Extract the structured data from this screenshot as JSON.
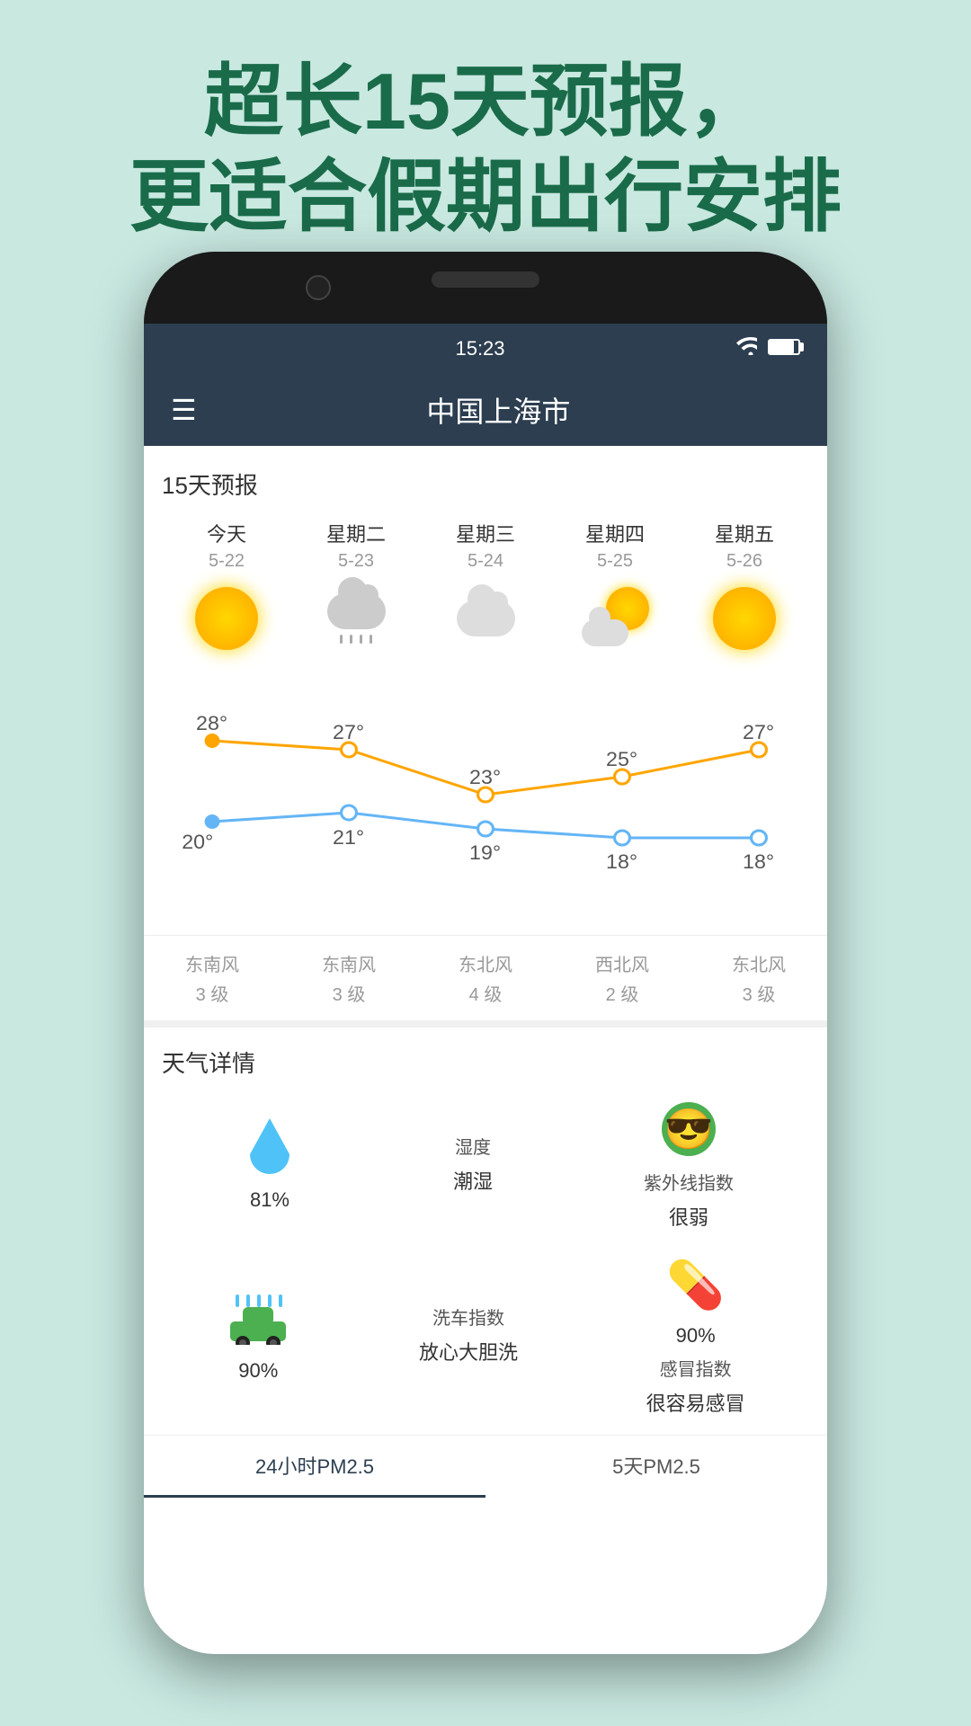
{
  "header": {
    "line1": "超长15天预报，",
    "line2": "更适合假期出行安排"
  },
  "statusBar": {
    "time": "15:23",
    "wifi": "📶",
    "battery": "🔋"
  },
  "appBar": {
    "title": "中国上海市",
    "menuIcon": "☰"
  },
  "weather": {
    "sectionTitle": "15天预报",
    "days": [
      {
        "name": "今天",
        "date": "5-22",
        "type": "sunny",
        "high": 28,
        "low": 20,
        "windDir": "东南风",
        "windLevel": "3 级"
      },
      {
        "name": "星期二",
        "date": "5-23",
        "type": "rainy",
        "high": 27,
        "low": 21,
        "windDir": "东南风",
        "windLevel": "3 级"
      },
      {
        "name": "星期三",
        "date": "5-24",
        "type": "cloudy",
        "high": 23,
        "low": 19,
        "windDir": "东北风",
        "windLevel": "4 级"
      },
      {
        "name": "星期四",
        "date": "5-25",
        "type": "suncloudy",
        "high": 25,
        "low": 18,
        "windDir": "西北风",
        "windLevel": "2 级"
      },
      {
        "name": "星期五",
        "date": "5-26",
        "type": "sunny",
        "high": 27,
        "low": 18,
        "windDir": "东北风",
        "windLevel": "3 级"
      }
    ]
  },
  "details": {
    "sectionTitle": "天气详情",
    "items": [
      {
        "icon": "waterdrop",
        "label": "",
        "value": "81%",
        "name": "humidity"
      },
      {
        "icon": "none",
        "label": "湿度",
        "value": "潮湿",
        "name": "humidity-label"
      },
      {
        "icon": "smiley",
        "label": "紫外线指数",
        "value": "",
        "name": "uv-index"
      },
      {
        "icon": "carwash",
        "label": "",
        "value": "90%",
        "name": "carwash"
      },
      {
        "icon": "none",
        "label": "洗车指数",
        "value": "放心大胆洗",
        "name": "carwash-label"
      },
      {
        "icon": "pill",
        "label": "感冒指数",
        "value": "",
        "name": "cold-index"
      }
    ],
    "uvLabel": "紫外线指数",
    "uvValue": "很弱",
    "humidityValue": "81%",
    "humiditySubLabel": "潮湿",
    "carwashValue": "90%",
    "carwashLabel": "洗车指数",
    "carwashSub": "放心大胆洗",
    "coldLabel": "感冒指数",
    "coldValue": "很容易感冒",
    "coldIconValue": "90%"
  },
  "bottomTabs": [
    {
      "label": "24小时PM2.5",
      "active": true
    },
    {
      "label": "5天PM2.5",
      "active": false
    }
  ],
  "chart": {
    "highTemps": [
      28,
      27,
      23,
      25,
      27
    ],
    "lowTemps": [
      20,
      21,
      19,
      18,
      18
    ],
    "highColor": "#FFA500",
    "lowColor": "#64b5f6"
  }
}
